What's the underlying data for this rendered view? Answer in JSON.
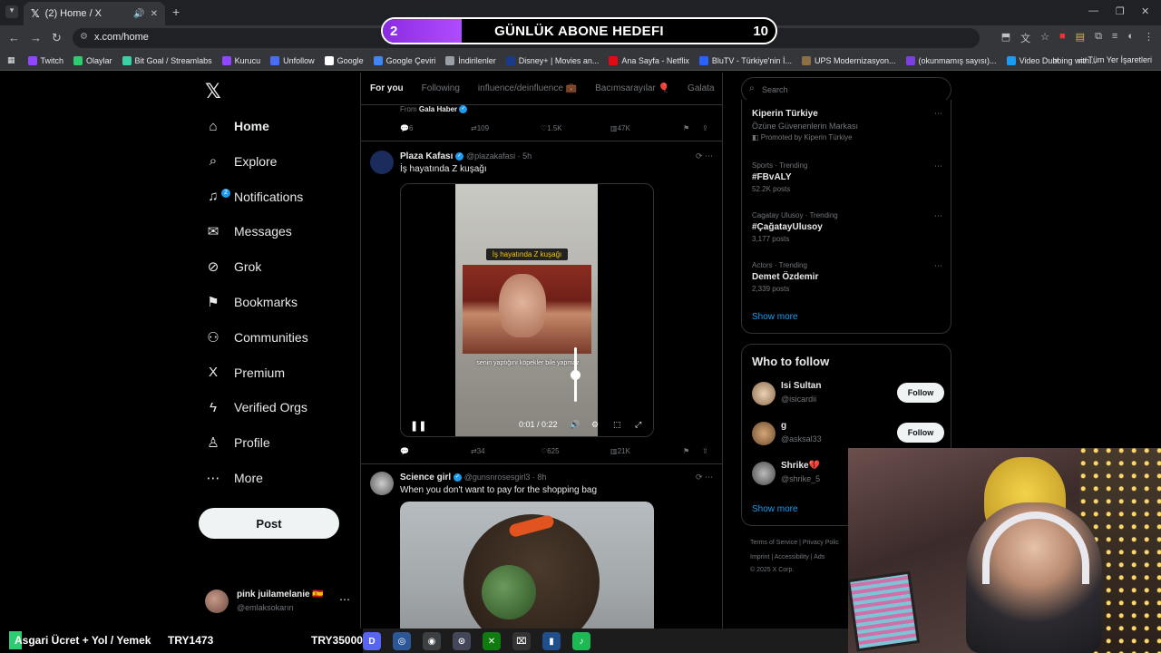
{
  "browser": {
    "tab_title": "(2) Home / X",
    "url": "x.com/home",
    "bookmarks": [
      {
        "label": "Twitch",
        "color": "#9146ff"
      },
      {
        "label": "Olaylar",
        "color": "#2ecc71"
      },
      {
        "label": "Bit Goal / Streamlabs",
        "color": "#3ad1a7"
      },
      {
        "label": "Kurucu",
        "color": "#9146ff"
      },
      {
        "label": "Unfollow",
        "color": "#4a6cf7"
      },
      {
        "label": "Google",
        "color": "#ffffff"
      },
      {
        "label": "Google Çeviri",
        "color": "#4285f4"
      },
      {
        "label": "İndirilenler",
        "color": "#9aa0a6"
      },
      {
        "label": "Disney+ | Movies an...",
        "color": "#1b3a8a"
      },
      {
        "label": "Ana Sayfa - Netflix",
        "color": "#e50914"
      },
      {
        "label": "BluTV - Türkiye'nin İ...",
        "color": "#2962ff"
      },
      {
        "label": "UPS Modernizasyon...",
        "color": "#8b6f47"
      },
      {
        "label": "(okunmamış sayısı)...",
        "color": "#7b3fe4"
      },
      {
        "label": "Video Dubbing with...",
        "color": "#1d9bf0"
      }
    ],
    "all_bookmarks": "Tüm Yer İşaretleri"
  },
  "goal": {
    "current": "2",
    "title": "GÜNLÜK ABONE HEDEFI",
    "target": "10",
    "progress": 0.2,
    "color": "#8a2be2"
  },
  "nav": {
    "items": [
      {
        "label": "Home",
        "icon": "home-icon",
        "glyph": "⌂"
      },
      {
        "label": "Explore",
        "icon": "search-icon",
        "glyph": "⌕"
      },
      {
        "label": "Notifications",
        "icon": "bell-icon",
        "glyph": "♫"
      },
      {
        "label": "Messages",
        "icon": "envelope-icon",
        "glyph": "✉"
      },
      {
        "label": "Grok",
        "icon": "grok-icon",
        "glyph": "⊘"
      },
      {
        "label": "Bookmarks",
        "icon": "bookmark-icon",
        "glyph": "⚑"
      },
      {
        "label": "Communities",
        "icon": "communities-icon",
        "glyph": "⚇"
      },
      {
        "label": "Premium",
        "icon": "x-premium-icon",
        "glyph": "X"
      },
      {
        "label": "Verified Orgs",
        "icon": "lightning-icon",
        "glyph": "ϟ"
      },
      {
        "label": "Profile",
        "icon": "person-icon",
        "glyph": "♙"
      },
      {
        "label": "More",
        "icon": "more-circle-icon",
        "glyph": "⋯"
      }
    ],
    "notifications_badge": "2",
    "post_label": "Post",
    "account_name": "pink juilamelanie 🇪🇸",
    "account_handle": "@emlaksokarın"
  },
  "feed": {
    "tabs": [
      "For you",
      "Following",
      "influence/deinfluence 💼",
      "Bacımsarayılar 🎈",
      "Galata"
    ],
    "prev_post": {
      "from_label": "From",
      "from_name": "Gala Haber",
      "replies": "6",
      "reposts": "109",
      "likes": "1.5K",
      "views": "47K"
    },
    "post1": {
      "name": "Plaza Kafası",
      "handle": "@plazakafasi · 5h",
      "text": "İş hayatında Z kuşağı",
      "video_caption_top": "İş hayatında Z kuşağı",
      "video_caption_bottom": "senin yaptığını köpekler bile yapmaz",
      "video_time": "0:01 / 0:22",
      "replies": "",
      "reposts": "34",
      "likes": "625",
      "views": "21K"
    },
    "post2": {
      "name": "Science girl",
      "handle": "@gunsnrosesgirl3 · 8h",
      "text": "When you don't want to pay for the shopping bag"
    }
  },
  "sidebar": {
    "search_placeholder": "Search",
    "promoted": {
      "title": "Kiperin Türkiye",
      "subtitle": "Özüne Güvenenlerin Markası",
      "promoted_by": "Promoted by Kiperin Türkiye"
    },
    "trends": [
      {
        "meta": "Sports · Trending",
        "title": "#FBvALY",
        "count": "52.2K posts"
      },
      {
        "meta": "Cagatay Ulusoy · Trending",
        "title": "#ÇağatayUlusoy",
        "count": "3,177 posts"
      },
      {
        "meta": "Actors · Trending",
        "title": "Demet Özdemir",
        "count": "2,339 posts"
      }
    ],
    "show_more": "Show more",
    "who_to_follow": "Who to follow",
    "follow_suggestions": [
      {
        "name": "Isi Sultan",
        "handle": "@isicardii",
        "button": "Follow"
      },
      {
        "name": "g",
        "handle": "@asksal33",
        "button": "Follow"
      },
      {
        "name": "Shrike💔",
        "handle": "@shrike_5",
        "button": ""
      }
    ],
    "footer_line1": "Terms of Service  |  Privacy Polic",
    "footer_line2": "Imprint  |  Accessibility  |  Ads",
    "footer_line3": "© 2025 X Corp."
  },
  "stream_bar": {
    "ticker_label": "Asgari Ücret + Yol / Yemek",
    "ticker_value1": "TRY1473",
    "ticker_value2": "TRY35000"
  }
}
